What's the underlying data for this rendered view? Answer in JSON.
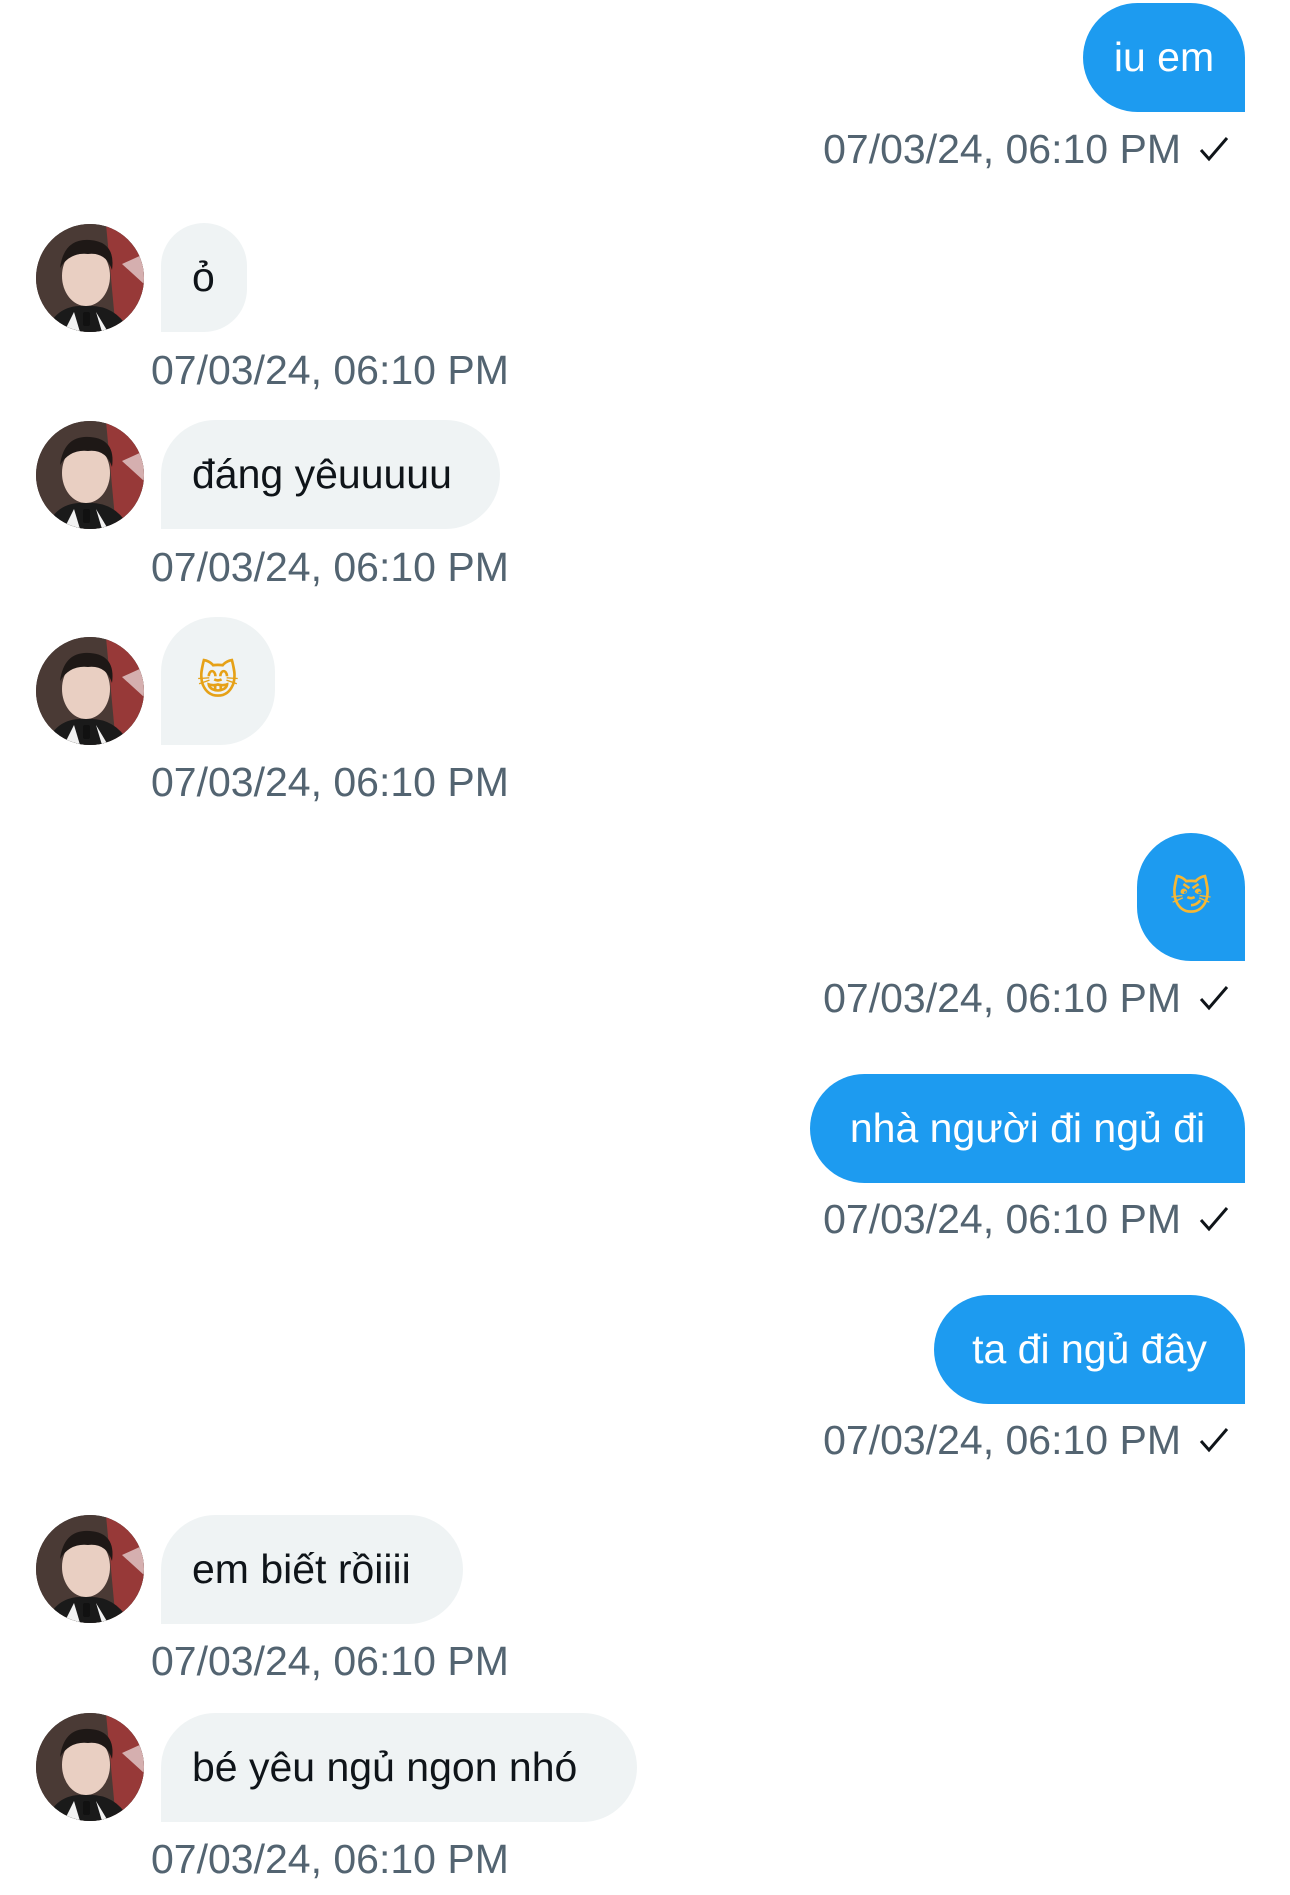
{
  "messages": [
    {
      "side": "sent",
      "text": "iu em",
      "time": "07/03/24, 06:10 PM",
      "emoji": false
    },
    {
      "side": "recv",
      "text": "ỏ",
      "time": "07/03/24, 06:10 PM",
      "emoji": false
    },
    {
      "side": "recv",
      "text": "đáng yêuuuuu",
      "time": "07/03/24, 06:10 PM",
      "emoji": false
    },
    {
      "side": "recv",
      "text": "😸",
      "time": "07/03/24, 06:10 PM",
      "emoji": true
    },
    {
      "side": "sent",
      "text": "😼",
      "time": "07/03/24, 06:10 PM",
      "emoji": true
    },
    {
      "side": "sent",
      "text": "nhà người đi ngủ đi",
      "time": "07/03/24, 06:10 PM",
      "emoji": false
    },
    {
      "side": "sent",
      "text": "ta đi ngủ đây",
      "time": "07/03/24, 06:10 PM",
      "emoji": false
    },
    {
      "side": "recv",
      "text": "em biết rồiiii",
      "time": "07/03/24, 06:10 PM",
      "emoji": false
    },
    {
      "side": "recv",
      "text": "bé yêu ngủ ngon nhó",
      "time": "07/03/24, 06:10 PM",
      "emoji": false
    }
  ],
  "icons": {
    "sent_status": "checkmark-icon",
    "avatar": "contact-avatar"
  },
  "colors": {
    "sent_bubble": "#1d9bf0",
    "received_bubble": "#eff3f4",
    "timestamp": "#536471",
    "background": "#ffffff"
  }
}
